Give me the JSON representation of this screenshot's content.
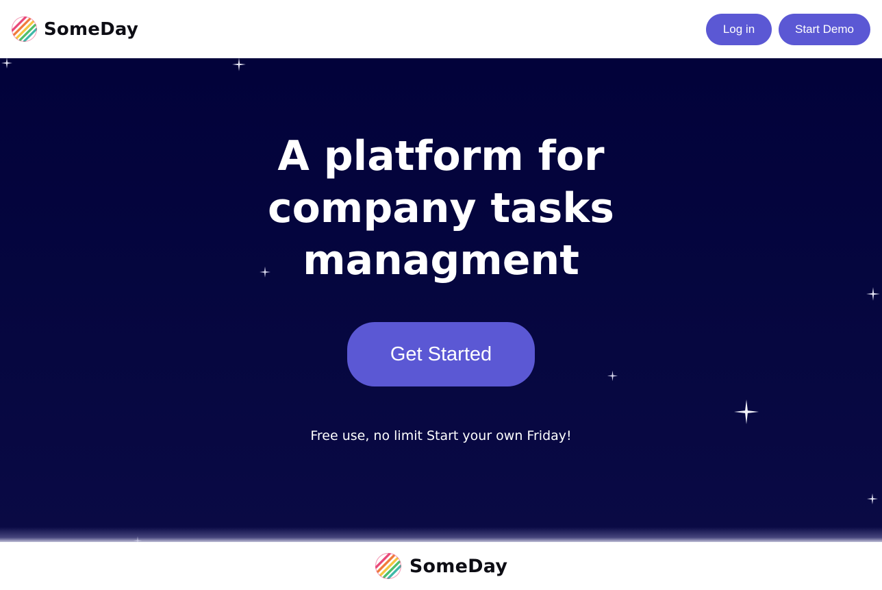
{
  "header": {
    "brand_name": "SomeDay",
    "logo_icon": "striped-circle-logo-icon",
    "login_label": "Log in",
    "demo_label": "Start Demo"
  },
  "hero": {
    "headline_lines": [
      "A platform for",
      "company tasks",
      "managment"
    ],
    "cta_label": "Get Started",
    "tagline": "Free use, no limit Start your own Friday!",
    "decoration_icon": "sparkle-star-icon"
  },
  "footer": {
    "brand_name": "SomeDay",
    "logo_icon": "striped-circle-logo-icon"
  },
  "colors": {
    "accent": "#5b58d4",
    "hero_background": "#04053d",
    "text_light": "#ffffff",
    "text_dark": "#0d0d14",
    "logo_stripes": [
      "#e94a7a",
      "#f07c3c",
      "#f4c542",
      "#4fbf6a",
      "#3fb8a8"
    ]
  }
}
